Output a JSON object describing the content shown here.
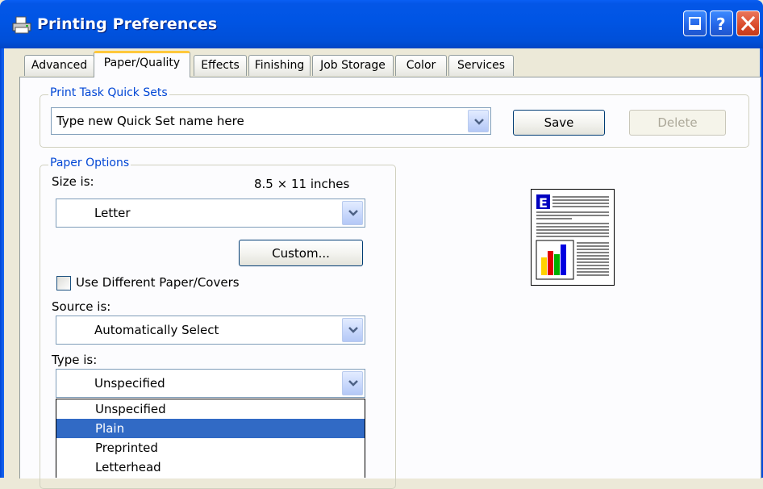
{
  "window": {
    "title": "Printing Preferences",
    "icon": "printer-icon",
    "controls": [
      "minimize-icon",
      "help-icon",
      "close-icon"
    ],
    "colors": {
      "titlebar": "#0055E5",
      "accent": "#0046D5",
      "selection": "#316AC5",
      "tab_highlight": "#FFC83C"
    }
  },
  "tabs": [
    {
      "label": "Advanced"
    },
    {
      "label": "Paper/Quality",
      "active": true
    },
    {
      "label": "Effects"
    },
    {
      "label": "Finishing"
    },
    {
      "label": "Job Storage"
    },
    {
      "label": "Color"
    },
    {
      "label": "Services"
    }
  ],
  "quick_sets": {
    "legend": "Print Task Quick Sets",
    "value": "Type new Quick Set name here",
    "save_label": "Save",
    "delete_label": "Delete"
  },
  "paper_options": {
    "legend": "Paper Options",
    "size_label": "Size is:",
    "size_dimensions": "8.5 × 11 inches",
    "size_value": "Letter",
    "custom_label": "Custom...",
    "different_paper_label": "Use Different Paper/Covers",
    "different_paper_checked": false,
    "source_label": "Source is:",
    "source_value": "Automatically Select",
    "type_label": "Type is:",
    "type_value": "Unspecified",
    "type_options": [
      {
        "label": "Unspecified",
        "selected": false
      },
      {
        "label": "Plain",
        "selected": true
      },
      {
        "label": "Preprinted",
        "selected": false
      },
      {
        "label": "Letterhead",
        "selected": false
      }
    ]
  },
  "preview": {
    "letter": "E",
    "bar_colors": [
      "#FFD200",
      "#E00000",
      "#00B000",
      "#0000E0"
    ]
  }
}
